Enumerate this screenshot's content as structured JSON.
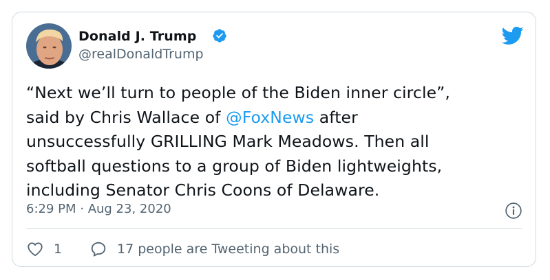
{
  "author": {
    "name": "Donald J. Trump",
    "handle": "@realDonaldTrump",
    "verified": true
  },
  "tweet": {
    "lines": [
      [
        "“Next we’ll turn to people of the Biden inner circle”,"
      ],
      [
        "said by Chris Wallace of ",
        "@FoxNews",
        " after"
      ],
      [
        "unsuccessfully GRILLING Mark Meadows. Then all"
      ],
      [
        "softball questions to a group of Biden lightweights,"
      ],
      [
        "including Senator Chris Coons of Delaware."
      ]
    ],
    "mention": "@FoxNews",
    "timestamp": "6:29 PM · Aug 23, 2020"
  },
  "actions": {
    "like_count": "1",
    "conversation_label": "17 people are Tweeting about this"
  },
  "icons": {
    "verified": "verified-badge-icon",
    "logo": "twitter-bird-icon",
    "info": "info-icon",
    "like": "heart-icon",
    "reply": "speech-bubble-icon"
  },
  "colors": {
    "accent": "#1d9bf0",
    "text": "#0f1419",
    "secondary": "#536471",
    "border": "#cfd9de"
  }
}
